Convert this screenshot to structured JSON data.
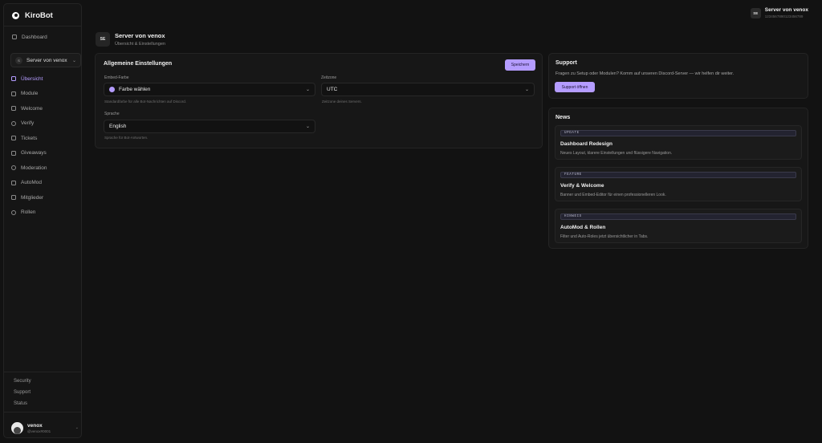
{
  "brand": {
    "name": "KiroBot"
  },
  "sidebar": {
    "dashboard_label": "Dashboard",
    "server_select": {
      "initial": "S",
      "label": "Server von venox"
    },
    "items": [
      {
        "label": "Übersicht",
        "icon": "chart-icon",
        "active": true
      },
      {
        "label": "Module",
        "icon": "module-icon"
      },
      {
        "label": "Welcome",
        "icon": "welcome-icon"
      },
      {
        "label": "Verify",
        "icon": "verify-icon"
      },
      {
        "label": "Tickets",
        "icon": "ticket-icon"
      },
      {
        "label": "Giveaways",
        "icon": "gift-icon"
      },
      {
        "label": "Moderation",
        "icon": "shield-icon"
      },
      {
        "label": "AutoMod",
        "icon": "automod-icon"
      },
      {
        "label": "Mitglieder",
        "icon": "users-icon"
      },
      {
        "label": "Rollen",
        "icon": "roles-icon"
      }
    ],
    "footer_links": [
      "Security",
      "Support",
      "Status"
    ],
    "user": {
      "name": "venox",
      "handle": "@venox#0001"
    }
  },
  "top_server": {
    "badge": "SE",
    "name": "Server von venox",
    "id": "1234567890123456789"
  },
  "page_header": {
    "badge": "SE",
    "title": "Server von venox",
    "subtitle": "Übersicht & Einstellungen"
  },
  "settings": {
    "title": "Allgemeine Einstellungen",
    "save_label": "Speichern",
    "embed_color": {
      "label": "Embed-Farbe",
      "value": "Farbe wählen",
      "hint": "Standardfarbe für alle Bot-Nachrichten auf Discord.",
      "color": "#b49cff"
    },
    "timezone": {
      "label": "Zeitzone",
      "value": "UTC",
      "hint": "Zeitzone deines Servers."
    },
    "language": {
      "label": "Sprache",
      "value": "English",
      "hint": "Sprache für Bot-Antworten."
    }
  },
  "support": {
    "title": "Support",
    "text": "Fragen zu Setup oder Modulen? Komm auf unseren Discord-Server — wir helfen dir weiter.",
    "button_label": "Support öffnen"
  },
  "news": {
    "title": "News",
    "items": [
      {
        "tag": "UPDATE",
        "title": "Dashboard Redesign",
        "desc": "Neues Layout, klarere Einstellungen und flüssigere Navigation."
      },
      {
        "tag": "FEATURE",
        "title": "Verify & Welcome",
        "desc": "Banner und Embed-Editor für einen professionelleren Look."
      },
      {
        "tag": "HINWEIS",
        "title": "AutoMod & Rollen",
        "desc": "Filter und Auto-Roles jetzt übersichtlicher in Tabs."
      }
    ]
  },
  "colors": {
    "accent": "#b49cff",
    "background": "#121212",
    "card": "#171717"
  }
}
